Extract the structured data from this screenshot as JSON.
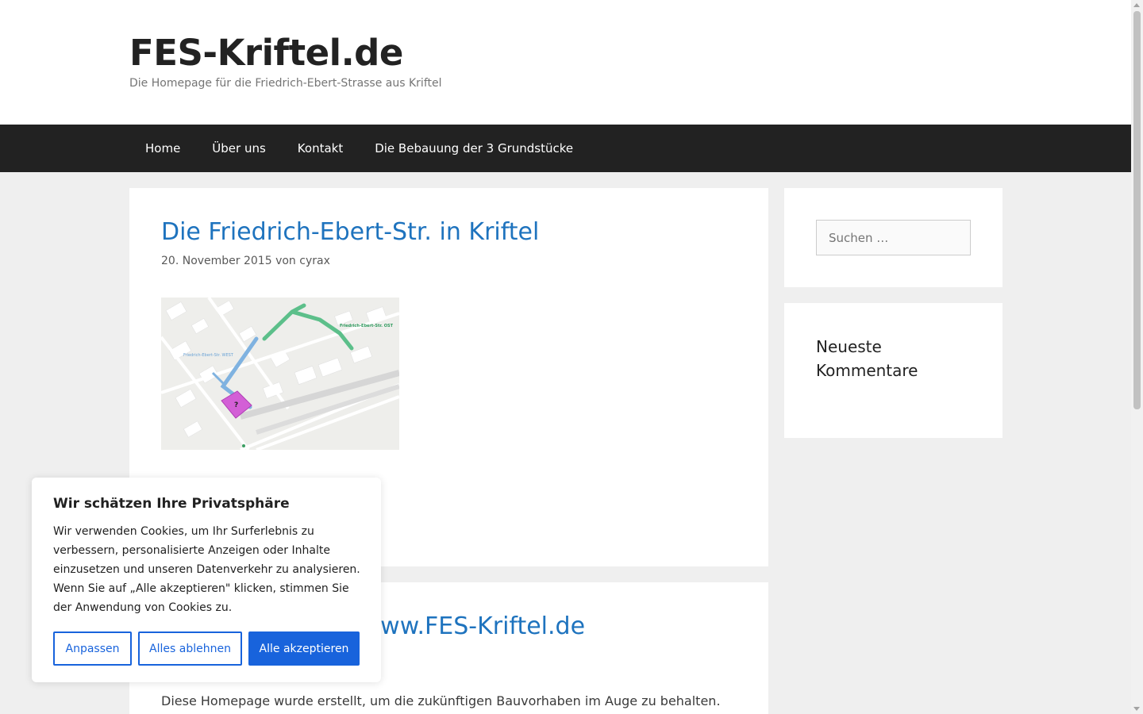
{
  "site": {
    "title": "FES-Kriftel.de",
    "tagline": "Die Homepage für die Friedrich-Ebert-Strasse aus Kriftel"
  },
  "nav": {
    "items": [
      {
        "label": "Home"
      },
      {
        "label": "Über uns"
      },
      {
        "label": "Kontakt"
      },
      {
        "label": "Die Bebauung der 3 Grundstücke"
      }
    ]
  },
  "posts": [
    {
      "title": "Die Friedrich-Ebert-Str. in Kriftel",
      "date": "20. November 2015",
      "by": "von",
      "author": "cyrax",
      "thumbnail": {
        "label_west": "Friedrich-Ebert-Str. WEST",
        "label_ost": "Friedrich-Ebert-Str. OST",
        "marker": "?"
      }
    },
    {
      "title": "Willkommen auf www.FES-Kriftel.de",
      "text": "Diese Homepage wurde erstellt, um die zukünftigen Bauvorhaben im Auge zu behalten."
    }
  ],
  "sidebar": {
    "search": {
      "placeholder": "Suchen …"
    },
    "recent_comments": {
      "title": "Neueste Kommentare"
    }
  },
  "cookie_banner": {
    "title": "Wir schätzen Ihre Privatsphäre",
    "text": "Wir verwenden Cookies, um Ihr Surferlebnis zu verbessern, personalisierte Anzeigen oder Inhalte einzusetzen und unseren Datenverkehr zu analysieren. Wenn Sie auf „Alle akzeptieren\" klicken, stimmen Sie der Anwendung von Cookies zu.",
    "btn_customize": "Anpassen",
    "btn_reject": "Alles ablehnen",
    "btn_accept": "Alle akzeptieren"
  },
  "colors": {
    "link": "#1e73be",
    "nav_bg": "#222222",
    "page_bg": "#efefef",
    "cookie_accent": "#1863dc",
    "map_street_west": "#7fb2e0",
    "map_street_ost": "#5cbf8a",
    "map_plot": "#d35fd6"
  }
}
